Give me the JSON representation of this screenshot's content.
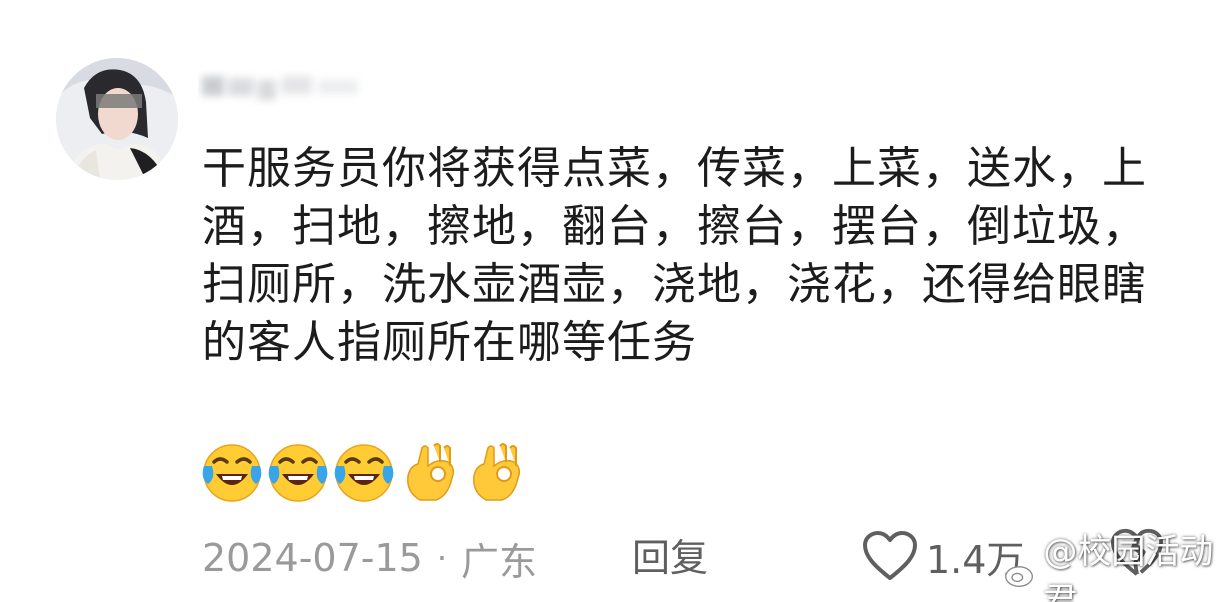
{
  "comment": {
    "username_blurred": "",
    "text": "干服务员你将获得点菜，传菜，上菜，送水，上酒，扫地，擦地，翻台，擦台，摆台，倒垃圾，扫厕所，洗水壶酒壶，浇地，浇花，还得给眼瞎的客人指厕所在哪等任务",
    "emojis": [
      "laughing-crying-emoji",
      "laughing-crying-emoji",
      "laughing-crying-emoji",
      "ok-hand-emoji",
      "ok-hand-emoji"
    ],
    "date": "2024-07-15",
    "separator": "·",
    "location": "广东",
    "reply_label": "回复",
    "like_count": "1.4万"
  },
  "watermark": {
    "text": "@校园活动君"
  },
  "colors": {
    "text": "#1c1c1c",
    "meta": "#9a9a9a",
    "action": "#5f5f5f"
  }
}
